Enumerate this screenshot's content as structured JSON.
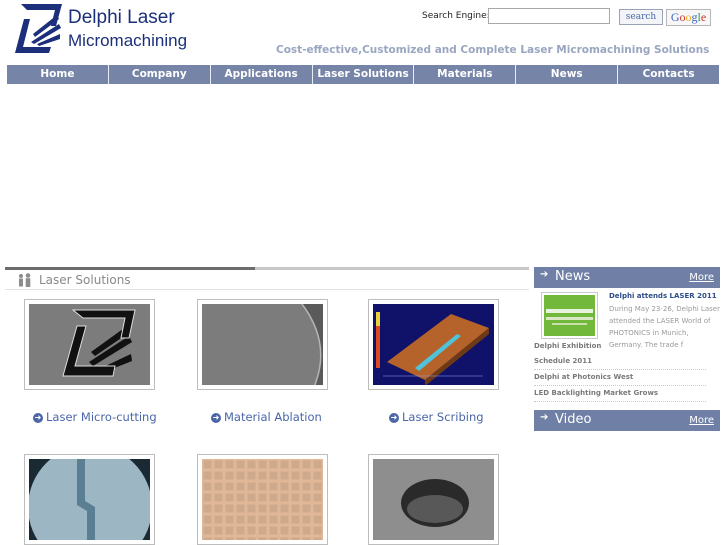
{
  "header": {
    "logo_line1": "Delphi Laser",
    "logo_line2": "Micromachining",
    "search_label": "Search Engine:",
    "search_value": "",
    "search_button": "search",
    "google_button": "Google",
    "tagline": "Cost-effective,Customized and Complete Laser Micromachining Solutions"
  },
  "nav": {
    "items": [
      "Home",
      "Company",
      "Applications",
      "Laser Solutions",
      "Materials",
      "News",
      "Contacts"
    ]
  },
  "section": {
    "title": "Laser Solutions"
  },
  "solutions": {
    "items": [
      {
        "label": "Laser Micro-cutting"
      },
      {
        "label": "Material Ablation"
      },
      {
        "label": "Laser Scribing"
      }
    ]
  },
  "news": {
    "title": "News",
    "more": "More",
    "headline": "Delphi attends LASER 2011",
    "body": "During May 23-26, Delphi Laser attended the LASER World of PHOTONICS in Munich, Germany. The trade f",
    "links": [
      "Delphi Exhibition",
      "Schedule 2011",
      "Delphi at Photonics West",
      "LED Backlighting Market Grows"
    ]
  },
  "video": {
    "title": "Video",
    "more": "More"
  },
  "colors": {
    "nav_bg": "#7584a7",
    "brand_blue": "#1b2f7a",
    "link_blue": "#4a66a8",
    "panel_bg": "#6f7fa6"
  }
}
